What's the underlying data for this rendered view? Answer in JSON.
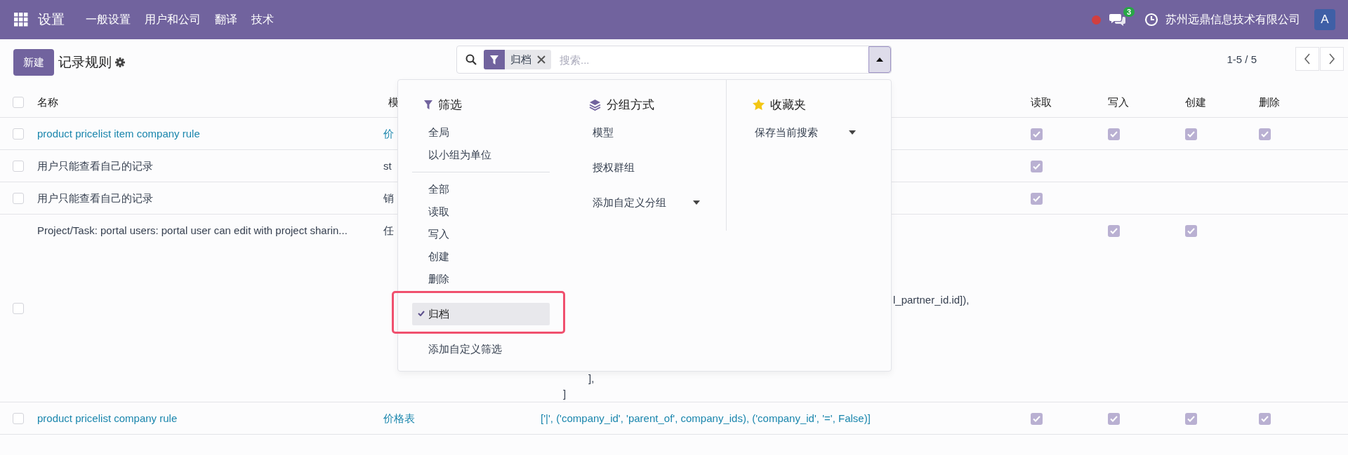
{
  "navbar": {
    "app": "设置",
    "menu": [
      {
        "label": "一般设置"
      },
      {
        "label": "用户和公司"
      },
      {
        "label": "翻译"
      },
      {
        "label": "技术"
      }
    ],
    "messages_badge": "3",
    "company": "苏州远鼎信息技术有限公司",
    "avatar": "A"
  },
  "control_panel": {
    "new_button": "新建",
    "title": "记录规则",
    "search": {
      "facets": [
        {
          "label": "归档"
        }
      ],
      "placeholder": "搜索..."
    },
    "pager": "1-5 / 5"
  },
  "filter_menu": {
    "filters": {
      "title": "筛选",
      "groups": [
        {
          "items": [
            {
              "label": "全局",
              "checked": false
            },
            {
              "label": "以小组为单位",
              "checked": false
            }
          ]
        },
        {
          "items": [
            {
              "label": "全部",
              "checked": false
            },
            {
              "label": "读取",
              "checked": false
            },
            {
              "label": "写入",
              "checked": false
            },
            {
              "label": "创建",
              "checked": false
            },
            {
              "label": "删除",
              "checked": false
            }
          ]
        },
        {
          "items": [
            {
              "label": "归档",
              "checked": true
            }
          ]
        }
      ],
      "add_custom": "添加自定义筛选"
    },
    "group_by": {
      "title": "分组方式",
      "options": [
        {
          "label": "模型",
          "kind": "option"
        },
        {
          "label": "授权群组",
          "kind": "option"
        },
        {
          "label": "添加自定义分组",
          "kind": "select"
        }
      ]
    },
    "favorites": {
      "title": "收藏夹",
      "items": [
        {
          "label": "保存当前搜索",
          "kind": "select"
        }
      ]
    }
  },
  "table": {
    "header": {
      "selected": false,
      "columns": [
        {
          "label": "名称"
        },
        {
          "label": "模"
        },
        {
          "label": "读取"
        },
        {
          "label": "写入"
        },
        {
          "label": "创建"
        },
        {
          "label": "删除"
        }
      ]
    },
    "rows": [
      {
        "kind": "line",
        "selected": false,
        "info": true,
        "name": "product pricelist item company rule",
        "model": "价",
        "perms": [
          true,
          true,
          true,
          true
        ]
      },
      {
        "kind": "line",
        "selected": false,
        "info": false,
        "name": "用户只能查看自己的记录",
        "model": "st",
        "perms": [
          true,
          false,
          false,
          false
        ]
      },
      {
        "kind": "line",
        "selected": false,
        "info": false,
        "name": "用户只能查看自己的记录",
        "model": "销",
        "perms": [
          true,
          false,
          false,
          false
        ]
      },
      {
        "kind": "tall",
        "selected": false,
        "info": false,
        "name": "Project/Task: portal users: portal user can edit with project sharin...",
        "model": "任",
        "domain": [
          "l_partner_id.id]),",
          "],",
          "]"
        ],
        "perms": [
          false,
          true,
          true,
          false
        ]
      },
      {
        "kind": "line",
        "selected": false,
        "info": true,
        "name": "product pricelist company rule",
        "model": "价格表",
        "domain": [
          "['|', ('company_id', 'parent_of', company_ids), ('company_id', '=', False)]"
        ],
        "perms": [
          true,
          true,
          true,
          true
        ]
      }
    ]
  }
}
